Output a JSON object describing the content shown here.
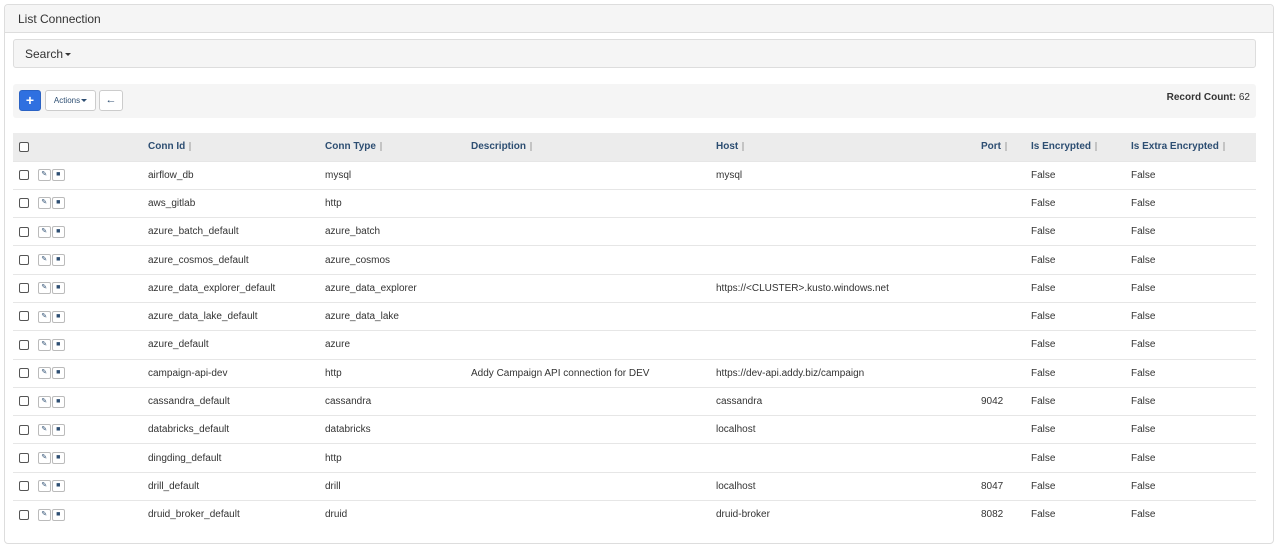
{
  "page": {
    "title": "List Connection"
  },
  "search": {
    "label": "Search"
  },
  "toolbar": {
    "add_label": "+",
    "actions_label": "Actions",
    "back_icon": "arrow-left-icon",
    "record_count_label": "Record Count:",
    "record_count_value": "62"
  },
  "colors": {
    "primary": "#2f70e0",
    "header_text": "#2d4e72"
  },
  "table": {
    "columns": [
      "Conn Id",
      "Conn Type",
      "Description",
      "Host",
      "Port",
      "Is Encrypted",
      "Is Extra Encrypted"
    ],
    "rows": [
      {
        "conn_id": "airflow_db",
        "conn_type": "mysql",
        "description": "",
        "host": "mysql",
        "port": "",
        "is_encrypted": "False",
        "is_extra_encrypted": "False"
      },
      {
        "conn_id": "aws_gitlab",
        "conn_type": "http",
        "description": "",
        "host": "",
        "port": "",
        "is_encrypted": "False",
        "is_extra_encrypted": "False"
      },
      {
        "conn_id": "azure_batch_default",
        "conn_type": "azure_batch",
        "description": "",
        "host": "",
        "port": "",
        "is_encrypted": "False",
        "is_extra_encrypted": "False"
      },
      {
        "conn_id": "azure_cosmos_default",
        "conn_type": "azure_cosmos",
        "description": "",
        "host": "",
        "port": "",
        "is_encrypted": "False",
        "is_extra_encrypted": "False"
      },
      {
        "conn_id": "azure_data_explorer_default",
        "conn_type": "azure_data_explorer",
        "description": "",
        "host": "https://<CLUSTER>.kusto.windows.net",
        "port": "",
        "is_encrypted": "False",
        "is_extra_encrypted": "False"
      },
      {
        "conn_id": "azure_data_lake_default",
        "conn_type": "azure_data_lake",
        "description": "",
        "host": "",
        "port": "",
        "is_encrypted": "False",
        "is_extra_encrypted": "False"
      },
      {
        "conn_id": "azure_default",
        "conn_type": "azure",
        "description": "",
        "host": "",
        "port": "",
        "is_encrypted": "False",
        "is_extra_encrypted": "False"
      },
      {
        "conn_id": "campaign-api-dev",
        "conn_type": "http",
        "description": "Addy Campaign API connection for DEV",
        "host": "https://dev-api.addy.biz/campaign",
        "port": "",
        "is_encrypted": "False",
        "is_extra_encrypted": "False"
      },
      {
        "conn_id": "cassandra_default",
        "conn_type": "cassandra",
        "description": "",
        "host": "cassandra",
        "port": "9042",
        "is_encrypted": "False",
        "is_extra_encrypted": "False"
      },
      {
        "conn_id": "databricks_default",
        "conn_type": "databricks",
        "description": "",
        "host": "localhost",
        "port": "",
        "is_encrypted": "False",
        "is_extra_encrypted": "False"
      },
      {
        "conn_id": "dingding_default",
        "conn_type": "http",
        "description": "",
        "host": "",
        "port": "",
        "is_encrypted": "False",
        "is_extra_encrypted": "False"
      },
      {
        "conn_id": "drill_default",
        "conn_type": "drill",
        "description": "",
        "host": "localhost",
        "port": "8047",
        "is_encrypted": "False",
        "is_extra_encrypted": "False"
      },
      {
        "conn_id": "druid_broker_default",
        "conn_type": "druid",
        "description": "",
        "host": "druid-broker",
        "port": "8082",
        "is_encrypted": "False",
        "is_extra_encrypted": "False"
      }
    ]
  }
}
